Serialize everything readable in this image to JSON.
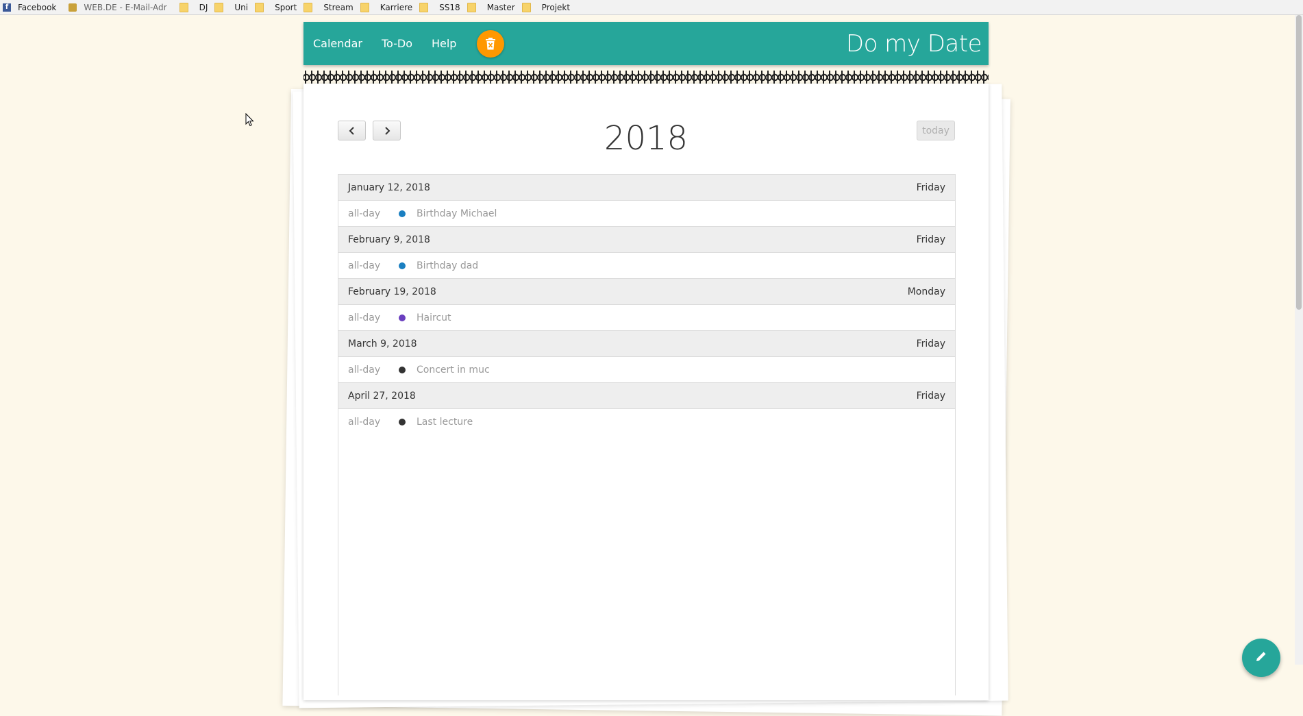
{
  "bookmarks": [
    {
      "label": "Facebook",
      "icon": "facebook-icon"
    },
    {
      "label": "WEB.DE - E-Mail-Adr",
      "icon": "webde-icon"
    },
    {
      "label": "DJ",
      "icon": "folder-icon"
    },
    {
      "label": "Uni",
      "icon": "folder-icon"
    },
    {
      "label": "Sport",
      "icon": "folder-icon"
    },
    {
      "label": "Stream",
      "icon": "folder-icon"
    },
    {
      "label": "Karriere",
      "icon": "folder-icon"
    },
    {
      "label": "SS18",
      "icon": "folder-icon"
    },
    {
      "label": "Master",
      "icon": "folder-icon"
    },
    {
      "label": "Projekt",
      "icon": "folder-icon"
    }
  ],
  "header": {
    "nav": [
      "Calendar",
      "To-Do",
      "Help"
    ],
    "brand": "Do my Date",
    "accent": "#26a69a",
    "trash_color": "#ff9800"
  },
  "calendar": {
    "title": "2018",
    "today_label": "today",
    "days": [
      {
        "date": "January 12, 2018",
        "weekday": "Friday",
        "events": [
          {
            "time": "all-day",
            "title": "Birthday Michael",
            "color": "#1a7fc1"
          }
        ]
      },
      {
        "date": "February 9, 2018",
        "weekday": "Friday",
        "events": [
          {
            "time": "all-day",
            "title": "Birthday dad",
            "color": "#1a7fc1"
          }
        ]
      },
      {
        "date": "February 19, 2018",
        "weekday": "Monday",
        "events": [
          {
            "time": "all-day",
            "title": "Haircut",
            "color": "#6a3fbf"
          }
        ]
      },
      {
        "date": "March 9, 2018",
        "weekday": "Friday",
        "events": [
          {
            "time": "all-day",
            "title": "Concert in muc",
            "color": "#333333"
          }
        ]
      },
      {
        "date": "April 27, 2018",
        "weekday": "Friday",
        "events": [
          {
            "time": "all-day",
            "title": "Last lecture",
            "color": "#333333"
          }
        ]
      }
    ]
  },
  "fab_icon": "pencil-icon"
}
